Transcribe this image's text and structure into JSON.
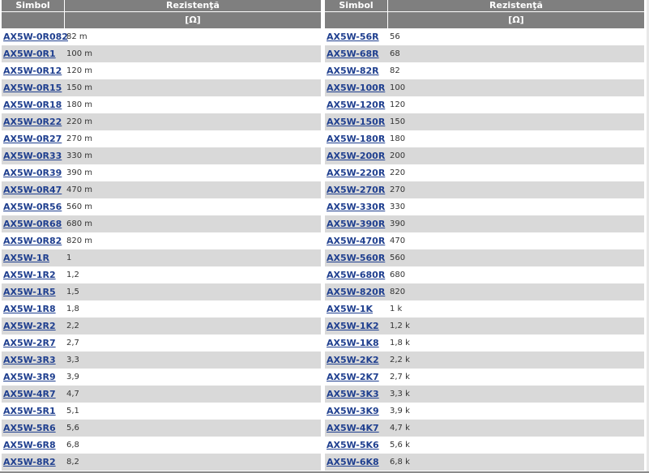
{
  "colors": {
    "header_bg": "#7f7f7f",
    "row_shade": "#d9d9d9",
    "link": "#1f3f8f"
  },
  "left": {
    "header": {
      "symbol": "Simbol",
      "resistance": "Rezistenţă",
      "unit": "[Ω]"
    },
    "rows": [
      {
        "symbol": "AX5W-0R082",
        "value": "82 m"
      },
      {
        "symbol": "AX5W-0R1",
        "value": "100 m"
      },
      {
        "symbol": "AX5W-0R12",
        "value": "120 m"
      },
      {
        "symbol": "AX5W-0R15",
        "value": "150 m"
      },
      {
        "symbol": "AX5W-0R18",
        "value": "180 m"
      },
      {
        "symbol": "AX5W-0R22",
        "value": "220 m"
      },
      {
        "symbol": "AX5W-0R27",
        "value": "270 m"
      },
      {
        "symbol": "AX5W-0R33",
        "value": "330 m"
      },
      {
        "symbol": "AX5W-0R39",
        "value": "390 m"
      },
      {
        "symbol": "AX5W-0R47",
        "value": "470 m"
      },
      {
        "symbol": "AX5W-0R56",
        "value": "560 m"
      },
      {
        "symbol": "AX5W-0R68",
        "value": "680 m"
      },
      {
        "symbol": "AX5W-0R82",
        "value": "820 m"
      },
      {
        "symbol": "AX5W-1R",
        "value": "1"
      },
      {
        "symbol": "AX5W-1R2",
        "value": "1,2"
      },
      {
        "symbol": "AX5W-1R5",
        "value": "1,5"
      },
      {
        "symbol": "AX5W-1R8",
        "value": "1,8"
      },
      {
        "symbol": "AX5W-2R2",
        "value": "2,2"
      },
      {
        "symbol": "AX5W-2R7",
        "value": "2,7"
      },
      {
        "symbol": "AX5W-3R3",
        "value": "3,3"
      },
      {
        "symbol": "AX5W-3R9",
        "value": "3,9"
      },
      {
        "symbol": "AX5W-4R7",
        "value": "4,7"
      },
      {
        "symbol": "AX5W-5R1",
        "value": "5,1"
      },
      {
        "symbol": "AX5W-5R6",
        "value": "5,6"
      },
      {
        "symbol": "AX5W-6R8",
        "value": "6,8"
      },
      {
        "symbol": "AX5W-8R2",
        "value": "8,2"
      }
    ]
  },
  "right": {
    "header": {
      "symbol": "Simbol",
      "resistance": "Rezistenţă",
      "unit": "[Ω]"
    },
    "rows": [
      {
        "symbol": "AX5W-56R",
        "value": "56"
      },
      {
        "symbol": "AX5W-68R",
        "value": "68"
      },
      {
        "symbol": "AX5W-82R",
        "value": "82"
      },
      {
        "symbol": "AX5W-100R",
        "value": "100"
      },
      {
        "symbol": "AX5W-120R",
        "value": "120"
      },
      {
        "symbol": "AX5W-150R",
        "value": "150"
      },
      {
        "symbol": "AX5W-180R",
        "value": "180"
      },
      {
        "symbol": "AX5W-200R",
        "value": "200"
      },
      {
        "symbol": "AX5W-220R",
        "value": "220"
      },
      {
        "symbol": "AX5W-270R",
        "value": "270"
      },
      {
        "symbol": "AX5W-330R",
        "value": "330"
      },
      {
        "symbol": "AX5W-390R",
        "value": "390"
      },
      {
        "symbol": "AX5W-470R",
        "value": "470"
      },
      {
        "symbol": "AX5W-560R",
        "value": "560"
      },
      {
        "symbol": "AX5W-680R",
        "value": "680"
      },
      {
        "symbol": "AX5W-820R",
        "value": "820"
      },
      {
        "symbol": "AX5W-1K",
        "value": "1 k"
      },
      {
        "symbol": "AX5W-1K2",
        "value": "1,2 k"
      },
      {
        "symbol": "AX5W-1K8",
        "value": "1,8 k"
      },
      {
        "symbol": "AX5W-2K2",
        "value": "2,2 k"
      },
      {
        "symbol": "AX5W-2K7",
        "value": "2,7 k"
      },
      {
        "symbol": "AX5W-3K3",
        "value": "3,3 k"
      },
      {
        "symbol": "AX5W-3K9",
        "value": "3,9 k"
      },
      {
        "symbol": "AX5W-4K7",
        "value": "4,7 k"
      },
      {
        "symbol": "AX5W-5K6",
        "value": "5,6 k"
      },
      {
        "symbol": "AX5W-6K8",
        "value": "6,8 k"
      }
    ]
  }
}
